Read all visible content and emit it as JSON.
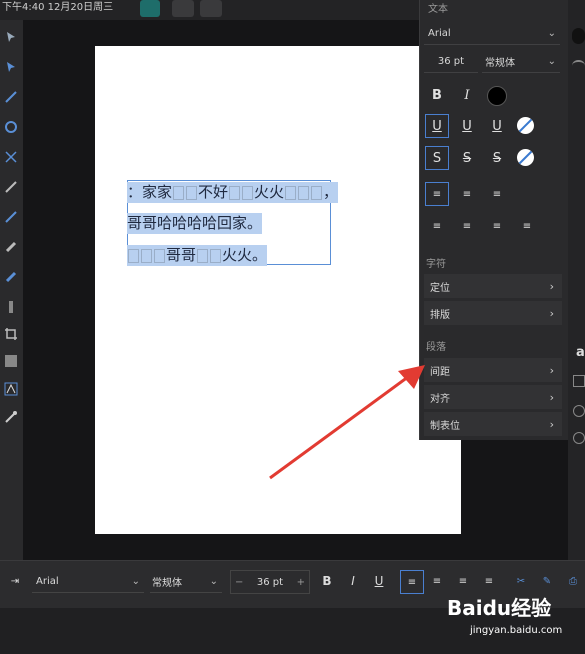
{
  "status": {
    "time": "下午4:40",
    "date": "12月20日周三"
  },
  "panel": {
    "title": "文本",
    "font_name": "Arial",
    "font_size": "36 pt",
    "font_style": "常规体",
    "section_char": "字符",
    "char_items": [
      "定位",
      "排版"
    ],
    "section_para": "段落",
    "para_items": [
      "间距",
      "对齐",
      "制表位"
    ]
  },
  "doc": {
    "line1": [
      "：家家",
      "不好",
      "火火",
      "，"
    ],
    "line2": "哥哥哈哈哈哈回家。",
    "line3": [
      "哥哥",
      "火火。"
    ]
  },
  "bottom": {
    "font_name": "Arial",
    "font_style": "常规体",
    "font_size": "36 pt",
    "bold": "B",
    "italic": "I",
    "underline": "U"
  },
  "watermark": {
    "brand": "Baidu经验",
    "url": "jingyan.baidu.com"
  },
  "colors": {
    "accent": "#4a7fd0",
    "arrow": "#e23b32",
    "selection": "#b8d0f0"
  }
}
